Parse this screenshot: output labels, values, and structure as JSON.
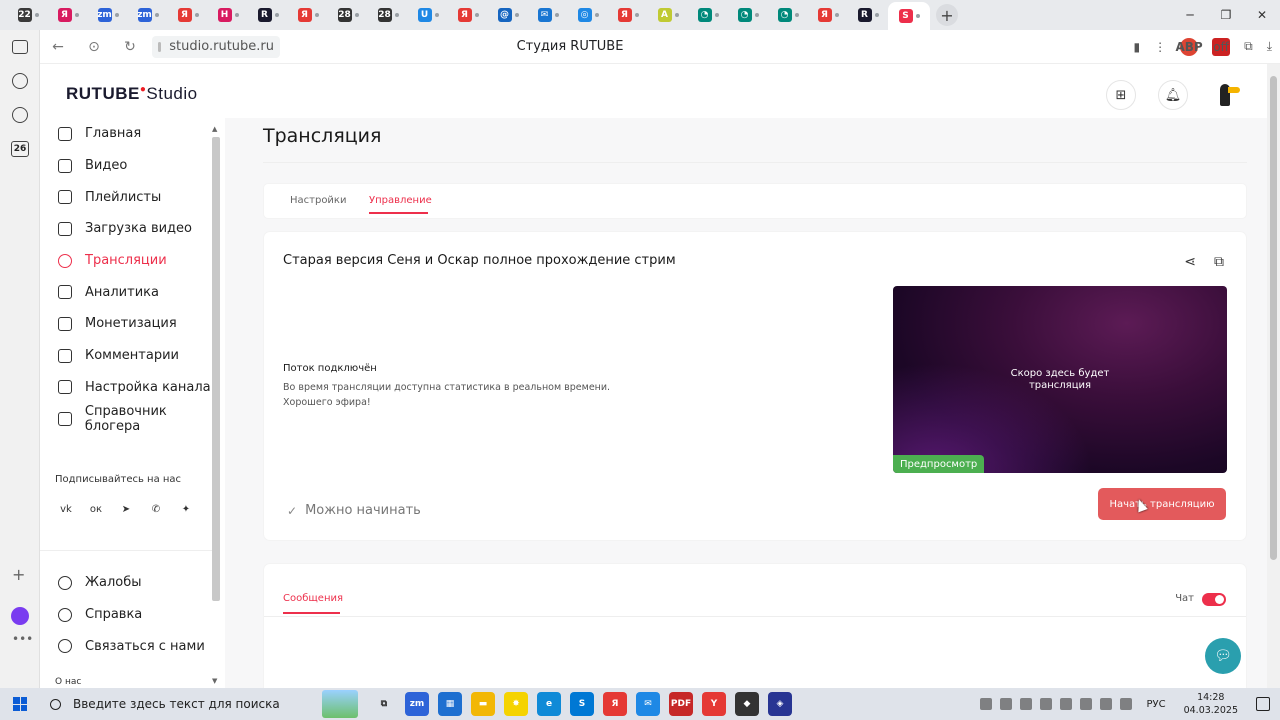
{
  "browser": {
    "url": "studio.rutube.ru",
    "page_title": "Студия RUTUBE",
    "tabs": [
      {
        "icon": "22",
        "color": "#3a3a3a"
      },
      {
        "icon": "Я",
        "color": "#d81b60"
      },
      {
        "icon": "zm",
        "color": "#2d63d8"
      },
      {
        "icon": "zm",
        "color": "#2d63d8"
      },
      {
        "icon": "Я",
        "color": "#e53935"
      },
      {
        "icon": "H",
        "color": "#d81b60"
      },
      {
        "icon": "R",
        "color": "#1a1a2e"
      },
      {
        "icon": "Я",
        "color": "#e53935"
      },
      {
        "icon": "28",
        "color": "#333333"
      },
      {
        "icon": "28",
        "color": "#333333"
      },
      {
        "icon": "U",
        "color": "#1e88e5"
      },
      {
        "icon": "Я",
        "color": "#e53935"
      },
      {
        "icon": "@",
        "color": "#1565c0"
      },
      {
        "icon": "✉",
        "color": "#1976d2"
      },
      {
        "icon": "◎",
        "color": "#1e88e5"
      },
      {
        "icon": "Я",
        "color": "#e53935"
      },
      {
        "icon": "A",
        "color": "#c0ca33"
      },
      {
        "icon": "◔",
        "color": "#00897b"
      },
      {
        "icon": "◔",
        "color": "#00897b"
      },
      {
        "icon": "◔",
        "color": "#00897b"
      },
      {
        "icon": "Я",
        "color": "#e53935"
      },
      {
        "icon": "R",
        "color": "#1a1a2e"
      },
      {
        "icon": "S",
        "color": "#ed2f4b"
      }
    ],
    "extensions": {
      "abp": "ABP",
      "off": "off"
    }
  },
  "os_sidebar": {
    "calendar_num": "26"
  },
  "studio": {
    "logo": {
      "main": "RUTUBE",
      "sub": "Studio"
    },
    "nav": [
      {
        "label": "Главная",
        "icon": "home-icon",
        "active": false
      },
      {
        "label": "Видео",
        "icon": "video-icon",
        "active": false
      },
      {
        "label": "Плейлисты",
        "icon": "playlist-icon",
        "active": false
      },
      {
        "label": "Загрузка видео",
        "icon": "upload-icon",
        "active": false
      },
      {
        "label": "Трансляции",
        "icon": "broadcast-icon",
        "active": true
      },
      {
        "label": "Аналитика",
        "icon": "analytics-icon",
        "active": false
      },
      {
        "label": "Монетизация",
        "icon": "ruble-icon",
        "active": false
      },
      {
        "label": "Комментарии",
        "icon": "comment-icon",
        "active": false
      },
      {
        "label": "Настройка канала",
        "icon": "settings-icon",
        "active": false
      },
      {
        "label": "Справочник блогера",
        "icon": "book-icon",
        "active": false
      }
    ],
    "follow_label": "Подписывайтесь на нас",
    "socials": [
      "vk-icon",
      "ok-icon",
      "telegram-icon",
      "viber-icon",
      "plus-icon"
    ],
    "social_glyphs": [
      "vk",
      "ок",
      "➤",
      "✆",
      "✦"
    ],
    "nav_bottom": [
      {
        "label": "Жалобы",
        "icon": "flag-icon"
      },
      {
        "label": "Справка",
        "icon": "help-icon"
      },
      {
        "label": "Связаться с нами",
        "icon": "mail-icon"
      }
    ],
    "about_label": "О нас"
  },
  "main": {
    "title": "Трансляция",
    "tabs": [
      {
        "label": "Настройки",
        "selected": false
      },
      {
        "label": "Управление",
        "selected": true
      }
    ],
    "stream": {
      "title": "Старая версия Сеня и Оскар полное прохождение стрим",
      "status_title": "Поток подключён",
      "status_text_1": "Во время трансляции доступна статистика в реальном времени.",
      "status_text_2": "Хорошего эфира!",
      "preview_text_1": "Скоро здесь будет",
      "preview_text_2": "трансляция",
      "preview_badge": "Предпросмотр",
      "ready_label": "Можно начинать",
      "start_button": "Начать трансляцию"
    },
    "messages": {
      "tab_label": "Сообщения",
      "chat_label": "Чат",
      "chat_enabled": true
    }
  },
  "taskbar": {
    "search_placeholder": "Введите здесь текст для поиска",
    "apps": [
      {
        "icon": "task-view-icon",
        "glyph": "⧉",
        "color": "#dfe3ea"
      },
      {
        "icon": "zoom-icon",
        "glyph": "zm",
        "color": "#2d63d8"
      },
      {
        "icon": "store-icon",
        "glyph": "▦",
        "color": "#1e6fd0"
      },
      {
        "icon": "explorer-icon",
        "glyph": "▬",
        "color": "#f2b705"
      },
      {
        "icon": "yandex-market-icon",
        "glyph": "✸",
        "color": "#f5d300"
      },
      {
        "icon": "edge-icon",
        "glyph": "e",
        "color": "#0f8ad7"
      },
      {
        "icon": "skype-icon",
        "glyph": "S",
        "color": "#0078d4"
      },
      {
        "icon": "yandex-browser-icon",
        "glyph": "Я",
        "color": "#e53935"
      },
      {
        "icon": "mail-icon",
        "glyph": "✉",
        "color": "#1e88e5"
      },
      {
        "icon": "pdf-icon",
        "glyph": "PDF",
        "color": "#c62828"
      },
      {
        "icon": "yandex-icon",
        "glyph": "Y",
        "color": "#e53935"
      },
      {
        "icon": "game-icon",
        "glyph": "◆",
        "color": "#333333"
      },
      {
        "icon": "shield-icon",
        "glyph": "◈",
        "color": "#283593"
      }
    ],
    "lang": "РУС",
    "time": "14:28",
    "date": "04.03.2025"
  }
}
